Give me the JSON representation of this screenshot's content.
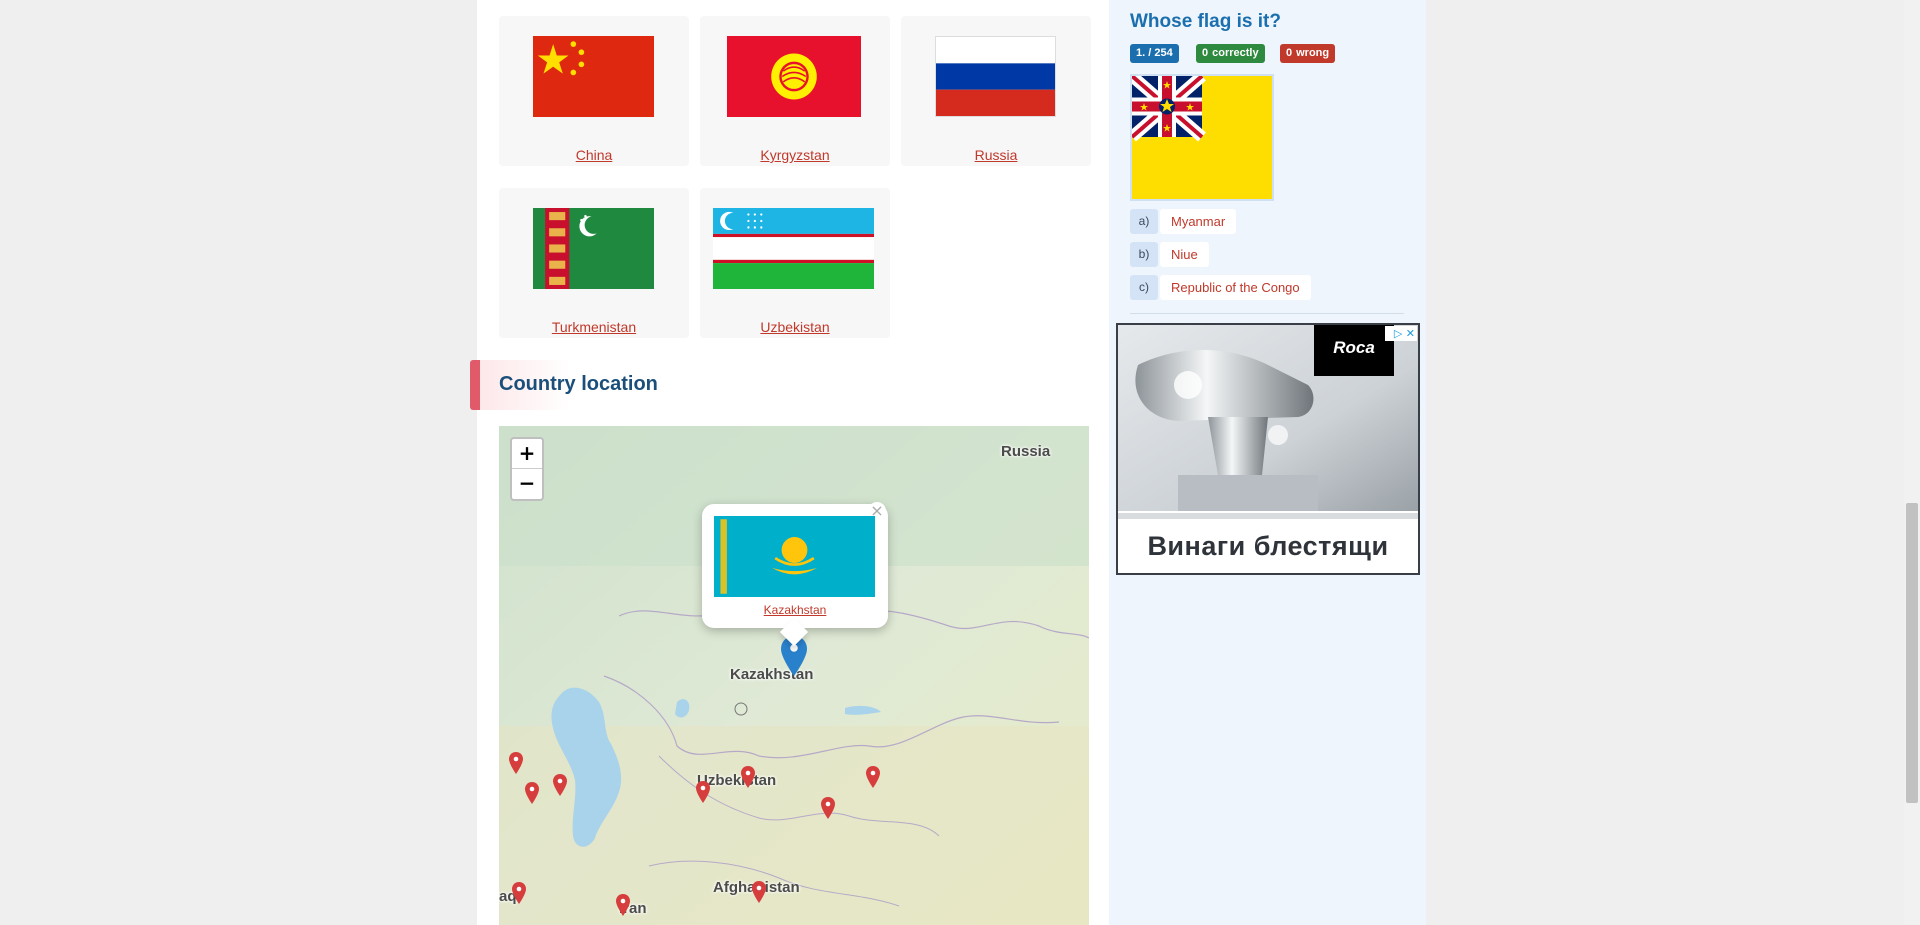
{
  "neighbours": [
    {
      "name": "China",
      "flag": "china-flag"
    },
    {
      "name": "Kyrgyzstan",
      "flag": "kyrgyzstan-flag"
    },
    {
      "name": "Russia",
      "flag": "russia-flag"
    },
    {
      "name": "Turkmenistan",
      "flag": "turkmenistan-flag"
    },
    {
      "name": "Uzbekistan",
      "flag": "uzbekistan-flag"
    }
  ],
  "section": {
    "title": "Country location"
  },
  "map": {
    "zoom_in": "+",
    "zoom_out": "−",
    "labels": {
      "russia": "Russia",
      "kazakhstan": "Kazakhstan",
      "uzbekistan": "Uzbekistan",
      "afghanistan": "Afghanistan",
      "iran": "Iran",
      "iraq": "aq"
    },
    "popup": {
      "country": "Kazakhstan",
      "close": "×"
    },
    "colors": {
      "land": "#dfe9d8",
      "water": "#a9d3ea",
      "pin_main": "#2a81cb",
      "pin_other": "#d63e3e"
    }
  },
  "quiz": {
    "title": "Whose flag is it?",
    "progress": {
      "current": "1.",
      "total": "/ 254"
    },
    "correct": {
      "count": "0",
      "label": "correctly"
    },
    "wrong": {
      "count": "0",
      "label": "wrong"
    },
    "flag": "niue-flag",
    "answers": [
      {
        "letter": "a)",
        "text": "Myanmar"
      },
      {
        "letter": "b)",
        "text": "Niue"
      },
      {
        "letter": "c)",
        "text": "Republic of the Congo"
      }
    ]
  },
  "ad": {
    "brand": "Roca",
    "slogan": "Винаги блестящи",
    "adchoices": "▷ ✕"
  }
}
